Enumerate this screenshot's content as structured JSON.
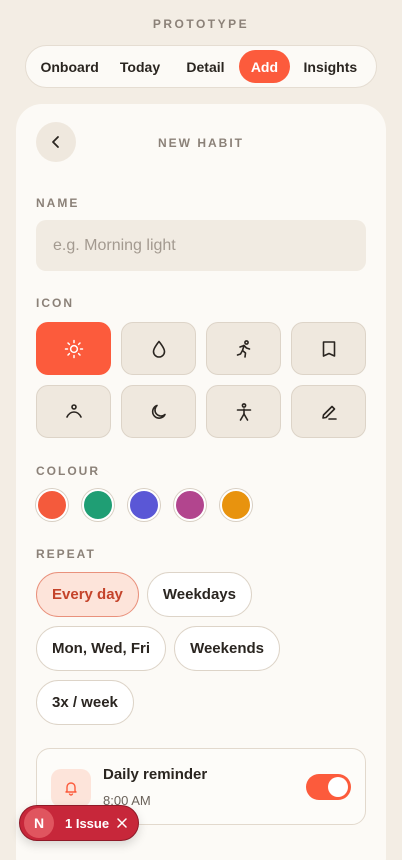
{
  "prototype_label": "PROTOTYPE",
  "tabs": [
    {
      "label": "Onboard"
    },
    {
      "label": "Today"
    },
    {
      "label": "Detail"
    },
    {
      "label": "Add"
    },
    {
      "label": "Insights"
    }
  ],
  "active_tab": "Add",
  "screen": {
    "title": "NEW HABIT",
    "back_icon": "chevron-left-icon",
    "name_label": "NAME",
    "name_placeholder": "e.g. Morning light",
    "name_value": "",
    "icon_label": "ICON",
    "icons": [
      "sun-icon",
      "droplet-icon",
      "running-icon",
      "book-icon",
      "meditate-icon",
      "moon-icon",
      "stretch-icon",
      "pen-icon"
    ],
    "selected_icon": "sun-icon",
    "colour_label": "COLOUR",
    "colours": [
      "#f45a3c",
      "#1f9e74",
      "#5a57d6",
      "#b2458e",
      "#e8930e"
    ],
    "selected_colour": "#f45a3c",
    "repeat_label": "REPEAT",
    "repeat_options": [
      "Every day",
      "Weekdays",
      "Mon, Wed, Fri",
      "Weekends",
      "3x / week"
    ],
    "selected_repeat": "Every day",
    "reminder": {
      "title": "Daily reminder",
      "time": "8:00 AM",
      "enabled": true,
      "icon": "bell-icon"
    }
  },
  "issue_badge": {
    "letter": "N",
    "text": "1 Issue"
  },
  "colors": {
    "accent": "#fc5b3c",
    "background": "#f3ede4",
    "card": "#fcfaf6",
    "issue": "#c7273a"
  }
}
